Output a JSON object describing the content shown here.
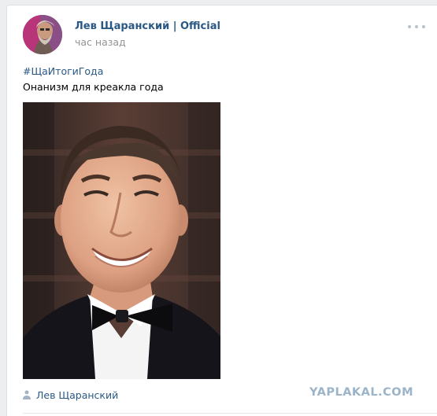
{
  "post": {
    "author": "Лев Щаранский | Official",
    "time": "час назад",
    "hashtag": "#ЩаИтогиГода",
    "text": "Онанизм для креакла года",
    "signer": "Лев Щаранский"
  },
  "icons": {
    "more": "more-dots-icon",
    "signer": "user-icon"
  },
  "colors": {
    "link": "#2a5885",
    "meta": "#939393",
    "background": "#edeef0",
    "card": "#ffffff"
  },
  "watermark": "YAPLAKAL.COM"
}
